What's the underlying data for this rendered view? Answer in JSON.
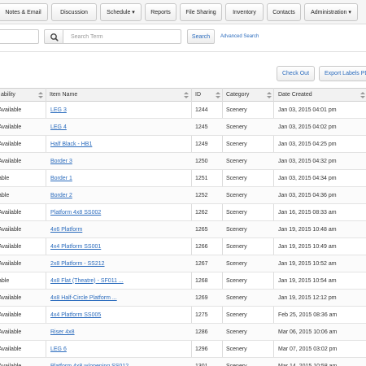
{
  "nav": {
    "tabs": [
      {
        "label": "Notes & Email"
      },
      {
        "label": "Discussion"
      },
      {
        "label": "Schedule ▾"
      },
      {
        "label": "Reports"
      },
      {
        "label": "File Sharing"
      },
      {
        "label": "Inventory"
      },
      {
        "label": "Contacts"
      },
      {
        "label": "Administration ▾"
      }
    ]
  },
  "search": {
    "placeholder": "Search Term",
    "value": "",
    "submit_label": "Search",
    "advanced_label": "Advanced Search"
  },
  "actions": {
    "checkout_label": "Check Out",
    "export_label": "Export Labels PDF"
  },
  "table": {
    "headers": {
      "availability": "ability",
      "name": "Item Name",
      "id": "ID",
      "category": "Category",
      "date": "Date Created"
    },
    "rows": [
      {
        "availability": "Available",
        "name": "LEG 3",
        "id": "1244",
        "category": "Scenery",
        "date": "Jan 03, 2015 04:01 pm"
      },
      {
        "availability": "Available",
        "name": "LEG 4",
        "id": "1245",
        "category": "Scenery",
        "date": "Jan 03, 2015 04:02 pm"
      },
      {
        "availability": "Available",
        "name": "Half Black - HB1",
        "id": "1249",
        "category": "Scenery",
        "date": "Jan 03, 2015 04:25 pm"
      },
      {
        "availability": "Available",
        "name": "Border 3",
        "id": "1250",
        "category": "Scenery",
        "date": "Jan 03, 2015 04:32 pm"
      },
      {
        "availability": "able",
        "name": "Border 1",
        "id": "1251",
        "category": "Scenery",
        "date": "Jan 03, 2015 04:34 pm"
      },
      {
        "availability": "able",
        "name": "Border 2",
        "id": "1252",
        "category": "Scenery",
        "date": "Jan 03, 2015 04:36 pm"
      },
      {
        "availability": "Available",
        "name": "Platform 4x8 SS002",
        "id": "1262",
        "category": "Scenery",
        "date": "Jan 16, 2015 08:33 am"
      },
      {
        "availability": "Available",
        "name": "4x6 Platform",
        "id": "1265",
        "category": "Scenery",
        "date": "Jan 19, 2015 10:48 am"
      },
      {
        "availability": "Available",
        "name": "4x4 Platform SS001",
        "id": "1266",
        "category": "Scenery",
        "date": "Jan 19, 2015 10:49 am"
      },
      {
        "availability": "Available",
        "name": "2x8 Platform - SS212",
        "id": "1267",
        "category": "Scenery",
        "date": "Jan 19, 2015 10:52 am"
      },
      {
        "availability": "able",
        "name": "4x8 Flat (Theatre) - SF011 ...",
        "id": "1268",
        "category": "Scenery",
        "date": "Jan 19, 2015 10:54 am"
      },
      {
        "availability": "Available",
        "name": "4x8 Half-Circle Platform ...",
        "id": "1269",
        "category": "Scenery",
        "date": "Jan 19, 2015 12:12 pm"
      },
      {
        "availability": "Available",
        "name": "4x4 Platform SS005",
        "id": "1275",
        "category": "Scenery",
        "date": "Feb 25, 2015 08:36 am"
      },
      {
        "availability": "Available",
        "name": "Riser 4x8",
        "id": "1286",
        "category": "Scenery",
        "date": "Mar 06, 2015 10:06 am"
      },
      {
        "availability": "Available",
        "name": "LEG 6",
        "id": "1296",
        "category": "Scenery",
        "date": "Mar 07, 2015 03:02 pm"
      },
      {
        "availability": "Available",
        "name": "Platform 4x8 w/opening SS012 ...",
        "id": "1301",
        "category": "Scenery",
        "date": "Mar 14, 2015 10:58 am"
      }
    ]
  },
  "colors": {
    "link": "#2a6bbd",
    "header_bg": "#f2f2f2",
    "nav_bg": "#f5f5f5"
  },
  "icons": {
    "search_button": "search-icon",
    "sort": "sort-icon"
  }
}
